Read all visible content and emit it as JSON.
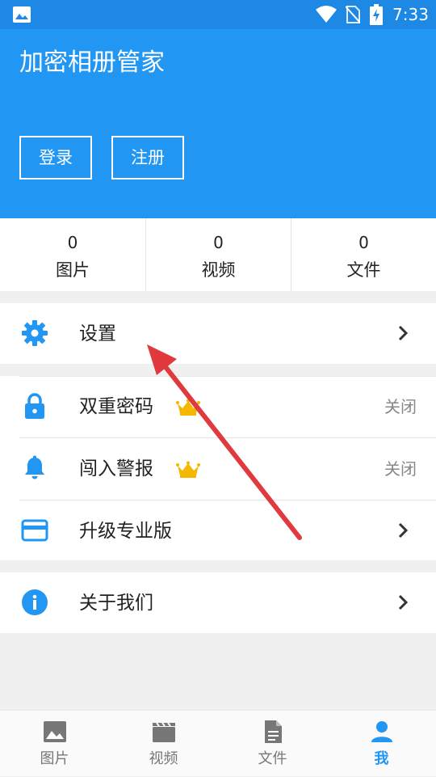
{
  "status_bar": {
    "time": "7:33",
    "icons": [
      "gallery-icon",
      "wifi-icon",
      "no-sim-icon",
      "battery-charging-icon"
    ]
  },
  "header": {
    "title": "加密相册管家",
    "login_label": "登录",
    "register_label": "注册"
  },
  "stats": [
    {
      "count": "0",
      "label": "图片"
    },
    {
      "count": "0",
      "label": "视频"
    },
    {
      "count": "0",
      "label": "文件"
    }
  ],
  "menu": {
    "settings": {
      "label": "设置",
      "icon": "gear-icon"
    },
    "double_password": {
      "label": "双重密码",
      "status": "关闭",
      "icon": "lock-icon",
      "badge": "crown-icon"
    },
    "intrusion_alert": {
      "label": "闯入警报",
      "status": "关闭",
      "icon": "bell-icon",
      "badge": "crown-icon"
    },
    "upgrade": {
      "label": "升级专业版",
      "icon": "credit-card-icon"
    },
    "about": {
      "label": "关于我们",
      "icon": "info-icon"
    }
  },
  "bottom_nav": {
    "items": [
      {
        "label": "图片",
        "icon": "image-icon",
        "active": false
      },
      {
        "label": "视频",
        "icon": "video-icon",
        "active": false
      },
      {
        "label": "文件",
        "icon": "file-icon",
        "active": false
      },
      {
        "label": "我",
        "icon": "person-icon",
        "active": true
      }
    ]
  },
  "colors": {
    "primary": "#2196F3",
    "status_bar": "#1E88E5",
    "background": "#F0F0F0",
    "annotation_arrow": "#E0393E",
    "crown": "#F5B800",
    "muted_text": "#888888"
  }
}
